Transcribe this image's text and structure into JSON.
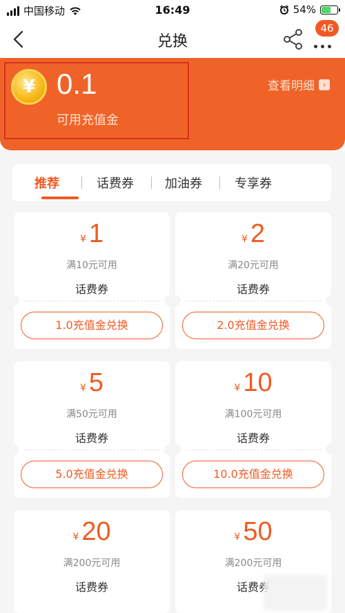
{
  "status_bar": {
    "carrier": "中国移动",
    "time": "16:49",
    "battery_percent": "54%",
    "battery_level": 0.54
  },
  "nav": {
    "title": "兑换",
    "badge_count": "46",
    "back_icon": "chevron-left-icon",
    "share_icon": "share-icon",
    "more_icon": "more-dots-icon"
  },
  "balance": {
    "coin_symbol": "¥",
    "amount": "0.1",
    "label": "可用充值金",
    "detail_link": "查看明细"
  },
  "tabs": [
    {
      "label": "推荐",
      "active": true
    },
    {
      "label": "话费券",
      "active": false
    },
    {
      "label": "加油券",
      "active": false
    },
    {
      "label": "专享券",
      "active": false
    }
  ],
  "coupons": [
    {
      "currency": "¥",
      "value": "1",
      "condition": "满10元可用",
      "type": "话费券",
      "button": "1.0充值金兑换"
    },
    {
      "currency": "¥",
      "value": "2",
      "condition": "满20元可用",
      "type": "话费券",
      "button": "2.0充值金兑换"
    },
    {
      "currency": "¥",
      "value": "5",
      "condition": "满50元可用",
      "type": "话费券",
      "button": "5.0充值金兑换"
    },
    {
      "currency": "¥",
      "value": "10",
      "condition": "满100元可用",
      "type": "话费券",
      "button": "10.0充值金兑换"
    },
    {
      "currency": "¥",
      "value": "20",
      "condition": "满200元可用",
      "type": "话费券",
      "button": ""
    },
    {
      "currency": "¥",
      "value": "50",
      "condition": "满200元可用",
      "type": "话费券",
      "button": ""
    }
  ],
  "colors": {
    "accent": "#f05a22",
    "banner": "#f06328",
    "highlight_box": "#d5321f",
    "page_bg": "#f5f5f5"
  }
}
